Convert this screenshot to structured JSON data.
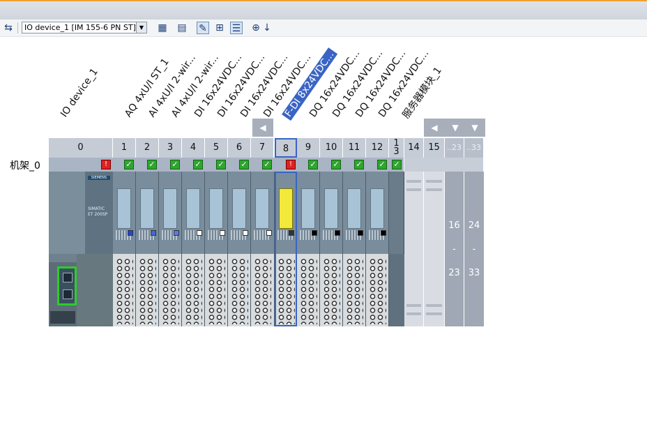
{
  "toolbar": {
    "device_selector_value": "IO device_1 [IM 155-6 PN ST]",
    "icons": [
      "network-view-icon",
      "device-dropdown",
      "show-addresses-icon",
      "show-names-icon",
      "show-icons-icon",
      "grid-icon",
      "table-icon",
      "zoom-icon",
      "zoom-dropdown-icon"
    ]
  },
  "device_labels": [
    "IO device_1",
    "AQ 4xU/I ST_1",
    "AI 4xU/I 2-wir...",
    "AI 4xU/I 2-wir...",
    "DI 16x24VDC...",
    "DI 16x24VDC...",
    "DI 16x24VDC...",
    "DI 16x24VDC...",
    "F-DI 8x24VDC...",
    "DQ 16x24VDC...",
    "DQ 16x24VDC...",
    "DQ 16x24VDC...",
    "DQ 16x24VDC...",
    "服务器模块_1"
  ],
  "slots": [
    "0",
    "1",
    "2",
    "3",
    "4",
    "5",
    "6",
    "7",
    "8",
    "9",
    "10",
    "11",
    "12",
    "1\n3",
    "14",
    "15",
    "..23",
    "..33"
  ],
  "rack_label": "机架_0",
  "range_blocks": [
    {
      "from": "16",
      "dash": "-",
      "to": "23"
    },
    {
      "from": "24",
      "dash": "-",
      "to": "33"
    }
  ],
  "status": [
    "error",
    "ok",
    "ok",
    "ok",
    "ok",
    "ok",
    "ok",
    "ok",
    "error",
    "ok",
    "ok",
    "ok",
    "ok",
    "ok"
  ],
  "colors": {
    "selection": "#3a64c4",
    "ok": "#2ea62e",
    "error": "#d22222",
    "failsafe_module": "#f2e93a"
  },
  "brand": "SIEMENS",
  "head_module_text": "SIMATIC ET 200SP"
}
